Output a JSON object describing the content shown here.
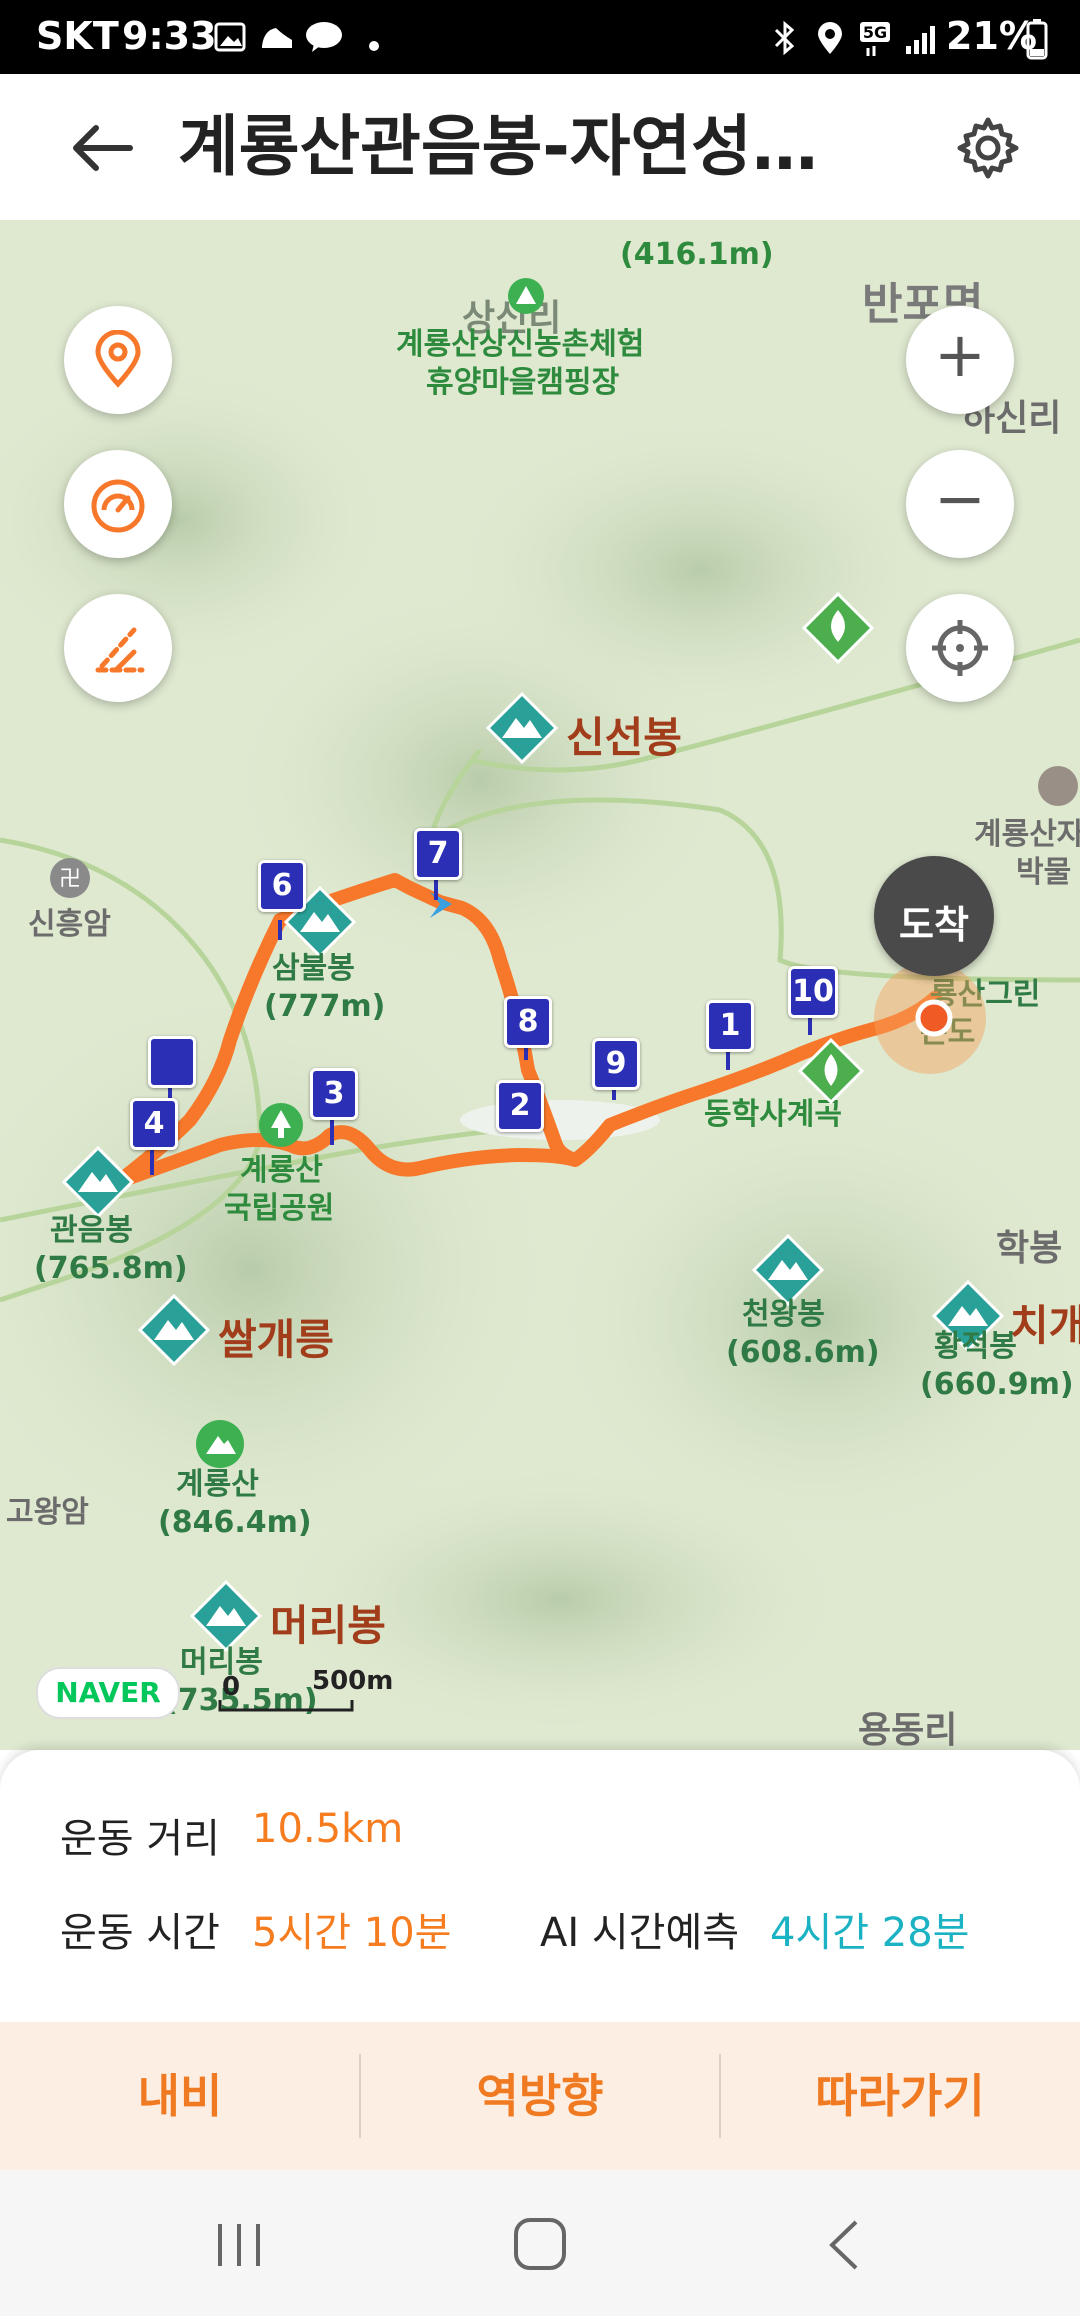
{
  "status": {
    "carrier": "SKT",
    "time": "9:33",
    "battery": "21%",
    "icons": [
      "gallery-icon",
      "shoe-icon",
      "talk-icon",
      "dot-icon",
      "bluetooth-icon",
      "location-icon",
      "5g-icon",
      "signal-icon",
      "battery-icon"
    ]
  },
  "header": {
    "title": "계룡산관음봉-자연성…",
    "back_icon": "back-arrow-icon",
    "settings_icon": "gear-icon"
  },
  "map": {
    "place_labels": {
      "top_peak": "(416.1m)",
      "sanggyeong": "상신리",
      "campsite_1": "계룡산상신농촌체험",
      "campsite_2": "휴양마을캠핑장",
      "banpo": "반포면",
      "hasinri": "하신리",
      "sinseonbong": "신선봉",
      "museum_1": "계룡산자",
      "museum_2": "박물",
      "sinheungam": "신흥암",
      "sambulbong": "삼불봉",
      "sambulbong_h": "(777m)",
      "park_1": "계룡산",
      "park_2": "국립공원",
      "gwaneumbong": "관음봉",
      "gwaneumbong_h": "(765.8m)",
      "ssalgaereung": "쌀개릉",
      "donghak": "동학사계곡",
      "hakbong": "학봉",
      "cheonwangbong": "천왕봉",
      "cheonwangbong_h": "(608.6m)",
      "hwanggeumbong": "황적봉",
      "hwanggeumbong_h": "(660.9m)",
      "chigae": "치개",
      "gyeryongsan": "계룡산",
      "gyeryongsan_h": "(846.4m)",
      "gowangam": "고왕암",
      "meoribong": "머리봉",
      "meoribong_small": "머리봉",
      "meoribong_h": "(735.5m)",
      "yongdongri": "용동리",
      "green_hotel_1": "룡산그린",
      "green_hotel_2": "콘도"
    },
    "waypoints": [
      "1",
      "2",
      "3",
      "4",
      "6",
      "7",
      "8",
      "9",
      "10"
    ],
    "arrival_label": "도착",
    "scale": {
      "zero": "0",
      "distance": "500m"
    },
    "logo": "NAVER",
    "controls": {
      "location_pin_icon": "location-pin-icon",
      "speed_icon": "speedometer-icon",
      "slope_icon": "slope-icon",
      "zoom_in": "+",
      "zoom_out": "−",
      "recenter_icon": "crosshair-icon"
    },
    "colors": {
      "route": "#f7782a",
      "waypoint": "#2b2fb5",
      "peak": "#2aa198"
    }
  },
  "stats": {
    "distance_label": "운동 거리",
    "distance_value": "10.5km",
    "time_label": "운동 시간",
    "time_value": "5시간 10분",
    "ai_label": "AI 시간예측",
    "ai_value": "4시간 28분"
  },
  "actions": {
    "navi": "내비",
    "reverse": "역방향",
    "follow": "따라가기"
  },
  "navbar": {
    "recent_icon": "recent-apps-icon",
    "home_icon": "home-icon",
    "back_icon": "nav-back-icon"
  }
}
